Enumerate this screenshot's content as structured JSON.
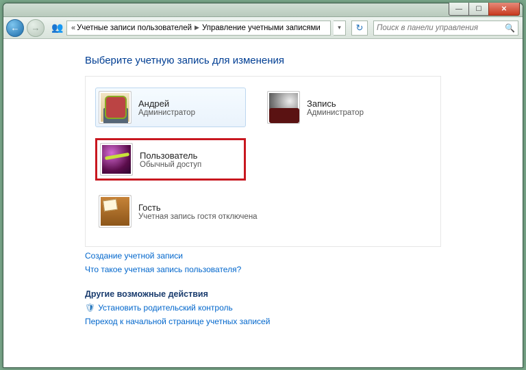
{
  "breadcrumb": {
    "level1": "Учетные записи пользователей",
    "level2": "Управление учетными записями"
  },
  "search": {
    "placeholder": "Поиск в панели управления"
  },
  "heading": "Выберите учетную запись для изменения",
  "accounts": [
    {
      "name": "Андрей",
      "role": "Администратор"
    },
    {
      "name": "Запись",
      "role": "Администратор"
    },
    {
      "name": "Пользователь",
      "role": "Обычный доступ"
    },
    {
      "name": "Гость",
      "role": "Учетная запись гостя отключена"
    }
  ],
  "links": {
    "create": "Создание учетной записи",
    "whatis": "Что такое учетная запись пользователя?"
  },
  "other": {
    "title": "Другие возможные действия",
    "parental": "Установить родительский контроль",
    "gohome": "Переход к начальной странице учетных записей"
  }
}
